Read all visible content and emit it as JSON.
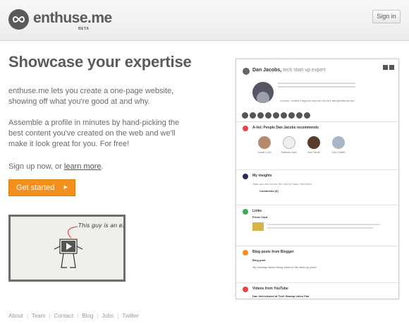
{
  "header": {
    "brand": "enthuse.me",
    "beta": "BETA",
    "signin_label": "Sign in"
  },
  "hero": {
    "headline": "Showcase your expertise",
    "para1": "enthuse.me lets you create a one-page website, showing off what you're good at and why.",
    "para2": "Assemble a profile in minutes by hand-picking the best content you've created on the web and we'll make it look great for you. For free!",
    "signup_prefix": "Sign up now, or ",
    "learn_more": "learn more",
    "signup_suffix": ".",
    "cta_label": "Get started",
    "cta_icon": "arrow-right-icon"
  },
  "video": {
    "note": "This guy is an expert"
  },
  "footer": {
    "links": [
      "About",
      "Team",
      "Contact",
      "Blog",
      "Jobs",
      "Twitter"
    ]
  },
  "preview": {
    "name": "Dan Jacobs,",
    "tagline": " tech start-up expert",
    "links_text": "London, United Kingdom   http://en.th.us/e   dan@enthuse.me",
    "sections": {
      "recommends": "A-list: People Dan Jacobs recommends",
      "people": [
        "Daniel Cohn",
        "Matthew Kane",
        "Alan Hewitt",
        "Toby Gattlet"
      ],
      "insights": "My insights",
      "insights_quote": "Start-ups are not for the faint of heart: therefore",
      "insights_sub": "Comments (0)",
      "links": "Links",
      "links_item": "Prime Card",
      "blog": "Blog posts from Blogger",
      "blog_item": "Blog post",
      "blog_sub": "My musings about being alone in the start-up world",
      "videos": "Videos from YouTube",
      "videos_item": "Dan interviewed at Tech Startup video Fair"
    }
  },
  "colors": {
    "accent": "#f28f1d",
    "text": "#5b5b5b",
    "red": "#e64545",
    "blue": "#2a5ea0",
    "green": "#3aaa55",
    "orange": "#f28f1d"
  }
}
